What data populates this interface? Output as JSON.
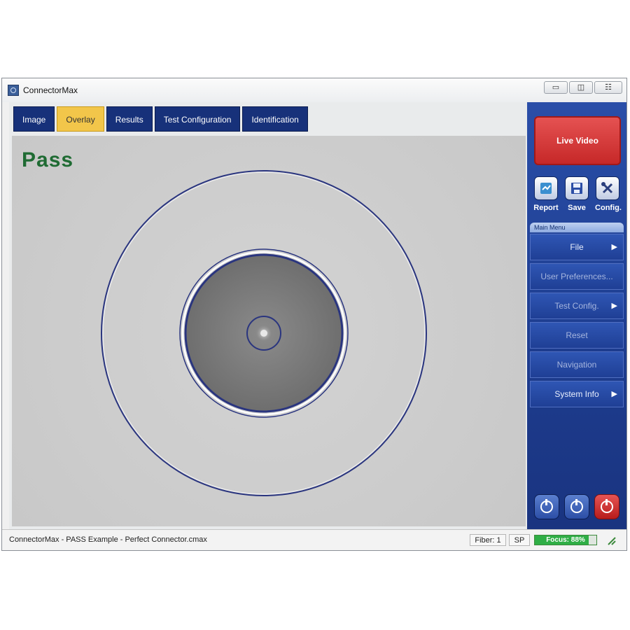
{
  "window": {
    "title": "ConnectorMax",
    "controls": [
      "▭",
      "◫",
      "☷"
    ]
  },
  "tabs": [
    {
      "label": "Image",
      "active": false
    },
    {
      "label": "Overlay",
      "active": true
    },
    {
      "label": "Results",
      "active": false
    },
    {
      "label": "Test Configuration",
      "active": false
    },
    {
      "label": "Identification",
      "active": false
    }
  ],
  "image": {
    "verdict": "Pass",
    "verdict_color": "#1f6b33"
  },
  "sidebar": {
    "live_video_label": "Live Video",
    "tools": [
      {
        "label": "Report",
        "icon": "report-icon"
      },
      {
        "label": "Save",
        "icon": "save-icon"
      },
      {
        "label": "Config.",
        "icon": "config-icon"
      }
    ],
    "menu_header": "Main Menu",
    "menu": [
      {
        "label": "File",
        "submenu": true,
        "enabled": true
      },
      {
        "label": "User Preferences...",
        "submenu": false,
        "enabled": false
      },
      {
        "label": "Test Config.",
        "submenu": true,
        "enabled": false
      },
      {
        "label": "Reset",
        "submenu": false,
        "enabled": false
      },
      {
        "label": "Navigation",
        "submenu": false,
        "enabled": false
      },
      {
        "label": "System Info",
        "submenu": true,
        "enabled": true
      }
    ]
  },
  "status": {
    "file_text": "ConnectorMax - PASS Example - Perfect Connector.cmax",
    "fiber": "Fiber: 1",
    "mode": "SP",
    "focus_label": "Focus: 88%",
    "focus_level": 0.88
  },
  "colors": {
    "accent_blue": "#17317a",
    "active_tab": "#f2c64a",
    "live_video": "#c62828",
    "overlay_ring": "#2a357f"
  }
}
